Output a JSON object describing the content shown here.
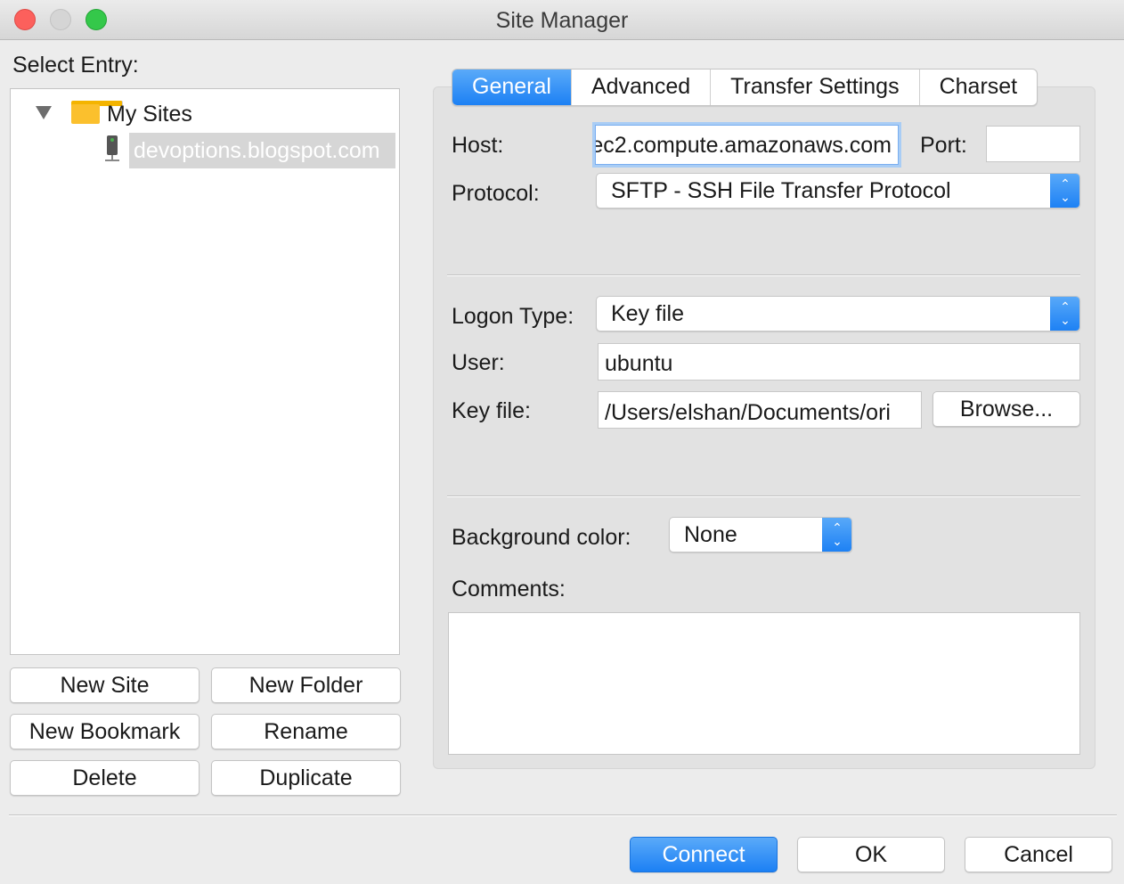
{
  "window": {
    "title": "Site Manager"
  },
  "left": {
    "select_entry_label": "Select Entry:",
    "tree": {
      "folder_label": "My Sites",
      "site_label": "devoptions.blogspot.com"
    },
    "buttons": {
      "new_site": "New Site",
      "new_folder": "New Folder",
      "new_bookmark": "New Bookmark",
      "rename": "Rename",
      "delete": "Delete",
      "duplicate": "Duplicate"
    }
  },
  "tabs": [
    "General",
    "Advanced",
    "Transfer Settings",
    "Charset"
  ],
  "general": {
    "host_label": "Host:",
    "host_value": "ec2.compute.amazonaws.com",
    "port_label": "Port:",
    "port_value": "",
    "protocol_label": "Protocol:",
    "protocol_value": "SFTP - SSH File Transfer Protocol",
    "logon_type_label": "Logon Type:",
    "logon_type_value": "Key file",
    "user_label": "User:",
    "user_value": "ubuntu",
    "key_file_label": "Key file:",
    "key_file_value": "/Users/elshan/Documents/ori",
    "browse_label": "Browse...",
    "bg_color_label": "Background color:",
    "bg_color_value": "None",
    "comments_label": "Comments:",
    "comments_value": ""
  },
  "footer": {
    "connect": "Connect",
    "ok": "OK",
    "cancel": "Cancel"
  },
  "colors": {
    "accent": "#1c80f4",
    "selection": "#d6d6d6",
    "close": "#fc605c",
    "maximize": "#34c84a"
  }
}
